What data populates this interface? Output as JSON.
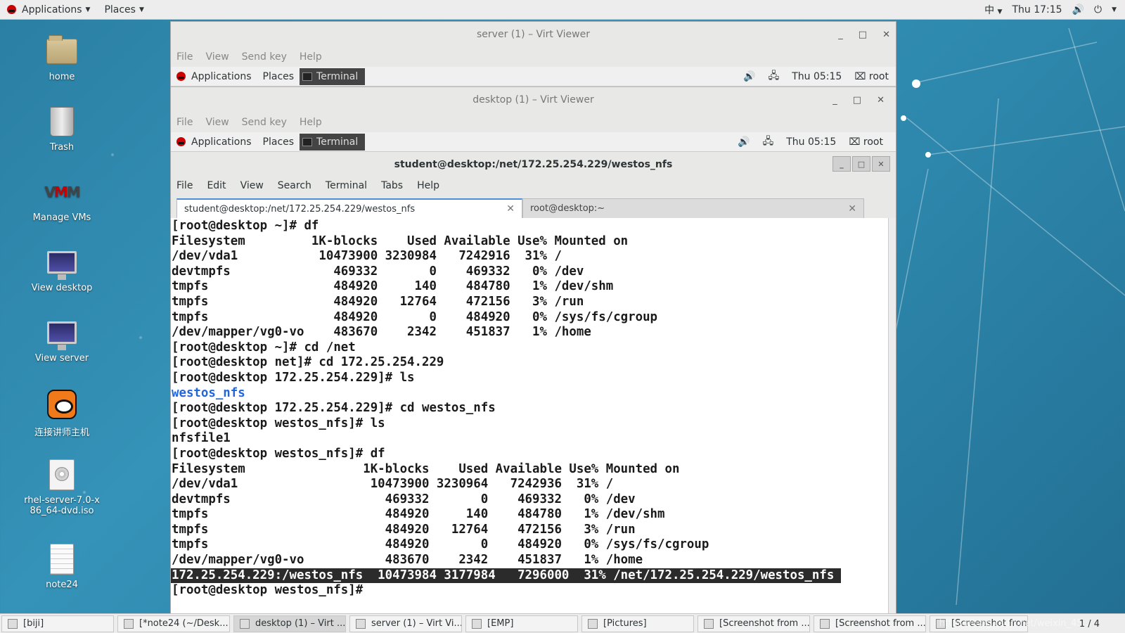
{
  "topbar": {
    "applications": "Applications",
    "places": "Places",
    "input_method": "中",
    "clock": "Thu 17:15"
  },
  "desktop_icons": [
    {
      "label": "home"
    },
    {
      "label": "Trash"
    },
    {
      "label": "Manage VMs"
    },
    {
      "label": "View desktop"
    },
    {
      "label": "View server"
    },
    {
      "label": "连接讲师主机"
    },
    {
      "label": "rhel-server-7.0-x86_64-dvd.iso"
    },
    {
      "label": "note24"
    }
  ],
  "server_viewer": {
    "title": "server (1) – Virt Viewer",
    "menu": [
      "File",
      "View",
      "Send key",
      "Help"
    ],
    "guest": {
      "applications": "Applications",
      "places": "Places",
      "terminal": "Terminal",
      "clock": "Thu 05:15",
      "user": "root"
    }
  },
  "desktop_viewer": {
    "title": "desktop (1) – Virt Viewer",
    "menu": [
      "File",
      "View",
      "Send key",
      "Help"
    ],
    "guest": {
      "applications": "Applications",
      "places": "Places",
      "terminal": "Terminal",
      "clock": "Thu 05:15",
      "user": "root"
    }
  },
  "terminal": {
    "title": "student@desktop:/net/172.25.254.229/westos_nfs",
    "menu": [
      "File",
      "Edit",
      "View",
      "Search",
      "Terminal",
      "Tabs",
      "Help"
    ],
    "tabs": [
      {
        "label": "student@desktop:/net/172.25.254.229/westos_nfs",
        "active": true
      },
      {
        "label": "root@desktop:~",
        "active": false
      }
    ],
    "lines": [
      "[root@desktop ~]# df",
      "Filesystem         1K-blocks    Used Available Use% Mounted on",
      "/dev/vda1           10473900 3230984   7242916  31% /",
      "devtmpfs              469332       0    469332   0% /dev",
      "tmpfs                 484920     140    484780   1% /dev/shm",
      "tmpfs                 484920   12764    472156   3% /run",
      "tmpfs                 484920       0    484920   0% /sys/fs/cgroup",
      "/dev/mapper/vg0-vo    483670    2342    451837   1% /home",
      "[root@desktop ~]# cd /net",
      "[root@desktop net]# cd 172.25.254.229",
      "[root@desktop 172.25.254.229]# ls",
      "westos_nfs",
      "[root@desktop 172.25.254.229]# cd westos_nfs",
      "[root@desktop westos_nfs]# ls",
      "nfsfile1",
      "[root@desktop westos_nfs]# df",
      "Filesystem                1K-blocks    Used Available Use% Mounted on",
      "/dev/vda1                  10473900 3230964   7242936  31% /",
      "devtmpfs                     469332       0    469332   0% /dev",
      "tmpfs                        484920     140    484780   1% /dev/shm",
      "tmpfs                        484920   12764    472156   3% /run",
      "tmpfs                        484920       0    484920   0% /sys/fs/cgroup",
      "/dev/mapper/vg0-vo           483670    2342    451837   1% /home",
      "172.25.254.229:/westos_nfs  10473984 3177984   7296000  31% /net/172.25.254.229/westos_nfs",
      "[root@desktop westos_nfs]# "
    ],
    "directory_line_index": 11,
    "highlight_line_index": 23
  },
  "taskbar": {
    "tasks": [
      {
        "label": "[biji]"
      },
      {
        "label": "[*note24 (~/Desk..."
      },
      {
        "label": "desktop (1) – Virt ..."
      },
      {
        "label": "server (1) – Virt Vi..."
      },
      {
        "label": "[EMP]"
      },
      {
        "label": "[Pictures]"
      },
      {
        "label": "[Screenshot from ..."
      },
      {
        "label": "[Screenshot from ..."
      },
      {
        "label": "[Screenshot from ..."
      }
    ],
    "pager": "1 / 4",
    "watermark": "https://blog.csdn.net/weixin_45..."
  }
}
